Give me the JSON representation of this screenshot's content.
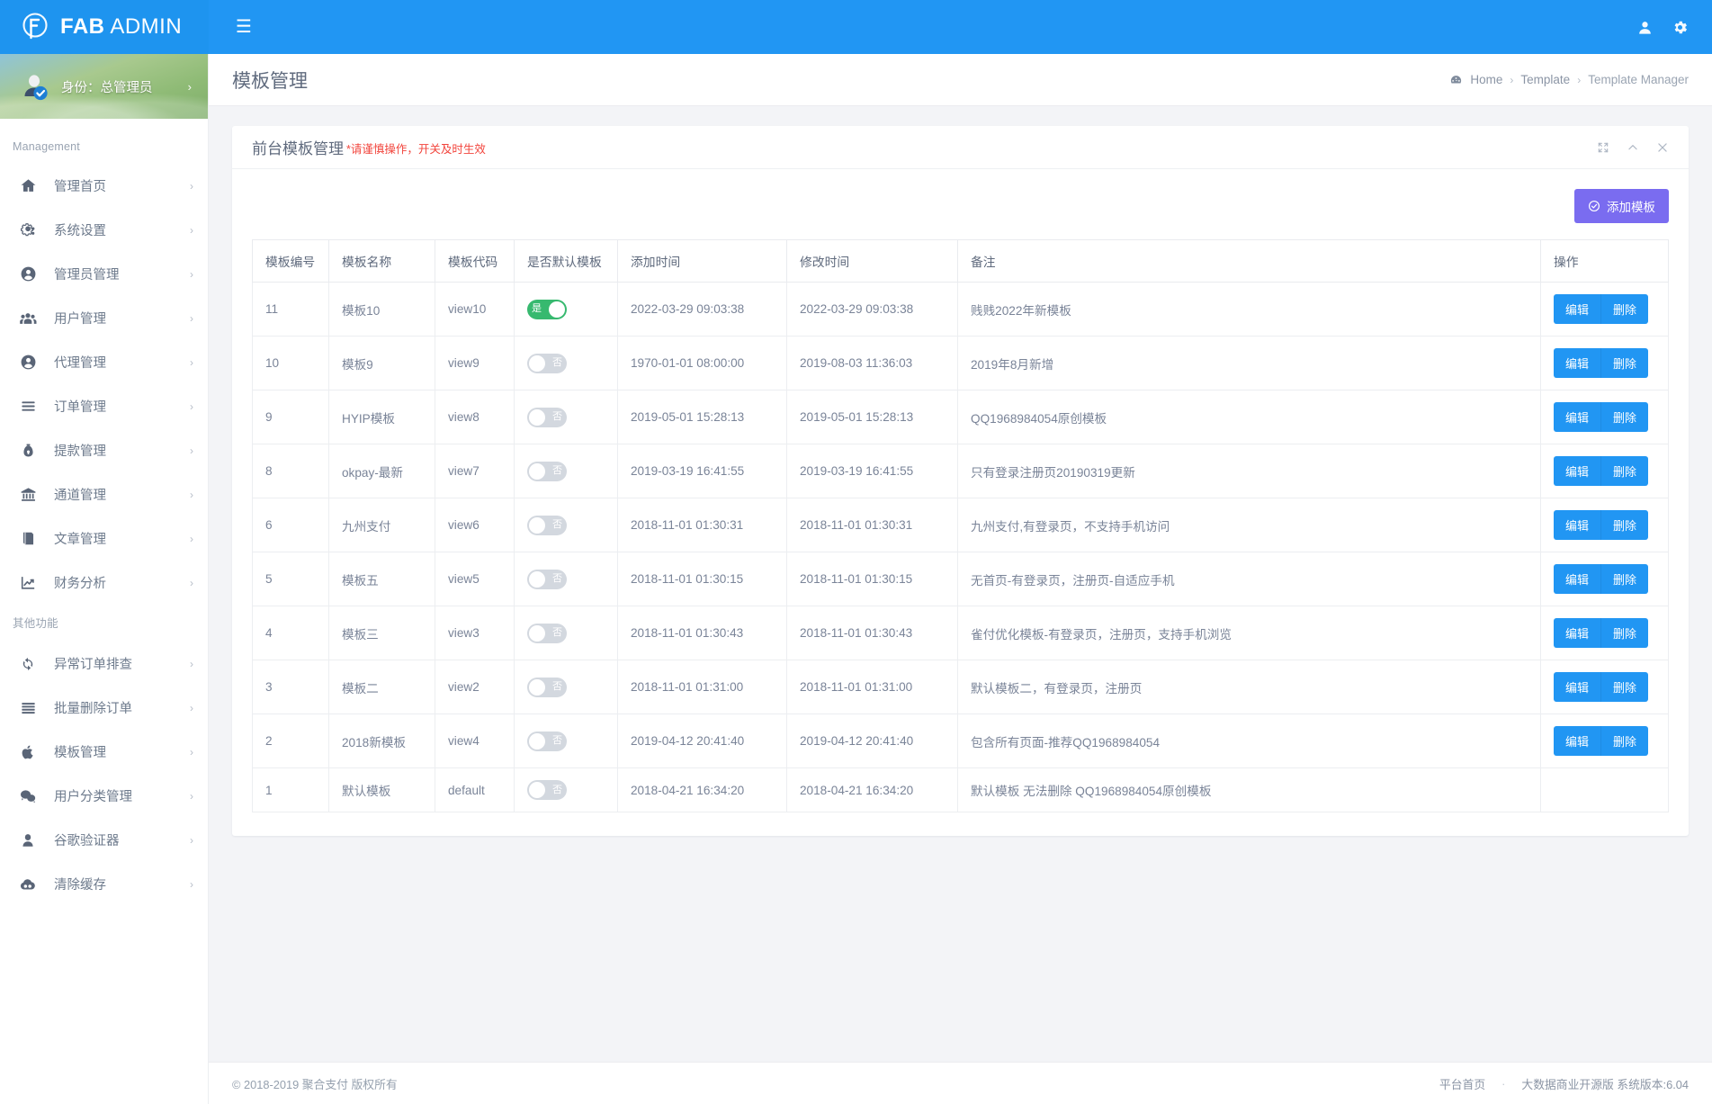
{
  "brand": {
    "bold": "FAB",
    "light": " ADMIN"
  },
  "topbar": {
    "menu_icon": "hamburger-icon",
    "user_icon": "user-icon",
    "settings_icon": "gear-icon"
  },
  "profile": {
    "name": "身份：总管理员",
    "caret": "›"
  },
  "sidebar": {
    "group_management": "Management",
    "group_other": "其他功能",
    "items_management": [
      {
        "label": "管理首页",
        "icon": "home-icon",
        "caret": "›"
      },
      {
        "label": "系统设置",
        "icon": "gears-icon",
        "caret": "›"
      },
      {
        "label": "管理员管理",
        "icon": "user-circle-icon",
        "caret": "›"
      },
      {
        "label": "用户管理",
        "icon": "users-icon",
        "caret": "›"
      },
      {
        "label": "代理管理",
        "icon": "user-circle-icon",
        "caret": "›"
      },
      {
        "label": "订单管理",
        "icon": "list-icon",
        "caret": "›"
      },
      {
        "label": "提款管理",
        "icon": "lock-bag-icon",
        "caret": "›"
      },
      {
        "label": "通道管理",
        "icon": "bank-icon",
        "caret": "›"
      },
      {
        "label": "文章管理",
        "icon": "book-icon",
        "caret": "›"
      },
      {
        "label": "财务分析",
        "icon": "chart-line-icon",
        "caret": "›"
      }
    ],
    "items_other": [
      {
        "label": "异常订单排查",
        "icon": "refresh-icon",
        "caret": "›"
      },
      {
        "label": "批量删除订单",
        "icon": "list-icon",
        "caret": "›"
      },
      {
        "label": "模板管理",
        "icon": "apple-icon",
        "caret": "›"
      },
      {
        "label": "用户分类管理",
        "icon": "wechat-icon",
        "caret": "›"
      },
      {
        "label": "谷歌验证器",
        "icon": "user-solid-icon",
        "caret": "›"
      },
      {
        "label": "清除缓存",
        "icon": "cloud-icon",
        "caret": "›"
      }
    ]
  },
  "page": {
    "title": "模板管理",
    "breadcrumb": [
      "Home",
      "Template",
      "Template Manager"
    ],
    "breadcrumb_icon": "dashboard-icon",
    "separator": "›"
  },
  "panel": {
    "title": "前台模板管理",
    "warning": "*请谨慎操作，开关及时生效",
    "tools": [
      "expand-icon",
      "collapse-icon",
      "close-icon"
    ],
    "add_button": "添加模板",
    "add_button_icon": "check-circle-icon",
    "add_button_color": "#7a6cf0"
  },
  "table": {
    "headers": [
      "模板编号",
      "模板名称",
      "模板代码",
      "是否默认模板",
      "添加时间",
      "修改时间",
      "备注",
      "操作"
    ],
    "edit_label": "编辑",
    "delete_label": "删除",
    "toggle_on_label": "是",
    "toggle_off_label": "否",
    "on_color": "#37b96f",
    "off_color": "#d3d8df",
    "rows": [
      {
        "id": "11",
        "name": "模板10",
        "code": "view10",
        "is_default": true,
        "added": "2022-03-29 09:03:38",
        "modified": "2022-03-29 09:03:38",
        "note": "贱贱2022年新模板",
        "has_actions": true
      },
      {
        "id": "10",
        "name": "模板9",
        "code": "view9",
        "is_default": false,
        "added": "1970-01-01 08:00:00",
        "modified": "2019-08-03 11:36:03",
        "note": "2019年8月新增",
        "has_actions": true
      },
      {
        "id": "9",
        "name": "HYIP模板",
        "code": "view8",
        "is_default": false,
        "added": "2019-05-01 15:28:13",
        "modified": "2019-05-01 15:28:13",
        "note": "QQ1968984054原创模板",
        "has_actions": true
      },
      {
        "id": "8",
        "name": "okpay-最新",
        "code": "view7",
        "is_default": false,
        "added": "2019-03-19 16:41:55",
        "modified": "2019-03-19 16:41:55",
        "note": "只有登录注册页20190319更新",
        "has_actions": true
      },
      {
        "id": "6",
        "name": "九州支付",
        "code": "view6",
        "is_default": false,
        "added": "2018-11-01 01:30:31",
        "modified": "2018-11-01 01:30:31",
        "note": "九州支付,有登录页，不支持手机访问",
        "has_actions": true
      },
      {
        "id": "5",
        "name": "模板五",
        "code": "view5",
        "is_default": false,
        "added": "2018-11-01 01:30:15",
        "modified": "2018-11-01 01:30:15",
        "note": "无首页-有登录页，注册页-自适应手机",
        "has_actions": true
      },
      {
        "id": "4",
        "name": "模板三",
        "code": "view3",
        "is_default": false,
        "added": "2018-11-01 01:30:43",
        "modified": "2018-11-01 01:30:43",
        "note": "雀付优化模板-有登录页，注册页，支持手机浏览",
        "has_actions": true
      },
      {
        "id": "3",
        "name": "模板二",
        "code": "view2",
        "is_default": false,
        "added": "2018-11-01 01:31:00",
        "modified": "2018-11-01 01:31:00",
        "note": "默认模板二，有登录页，注册页",
        "has_actions": true
      },
      {
        "id": "2",
        "name": "2018新模板",
        "code": "view4",
        "is_default": false,
        "added": "2019-04-12 20:41:40",
        "modified": "2019-04-12 20:41:40",
        "note": "包含所有页面-推荐QQ1968984054",
        "has_actions": true
      },
      {
        "id": "1",
        "name": "默认模板",
        "code": "default",
        "is_default": false,
        "added": "2018-04-21 16:34:20",
        "modified": "2018-04-21 16:34:20",
        "note": "默认模板 无法删除 QQ1968984054原创模板",
        "has_actions": false
      }
    ]
  },
  "footer": {
    "copyright": "© 2018-2019 聚合支付 版权所有",
    "link": "平台首页",
    "dot": "·",
    "version": "大数据商业开源版 系统版本:6.04"
  }
}
